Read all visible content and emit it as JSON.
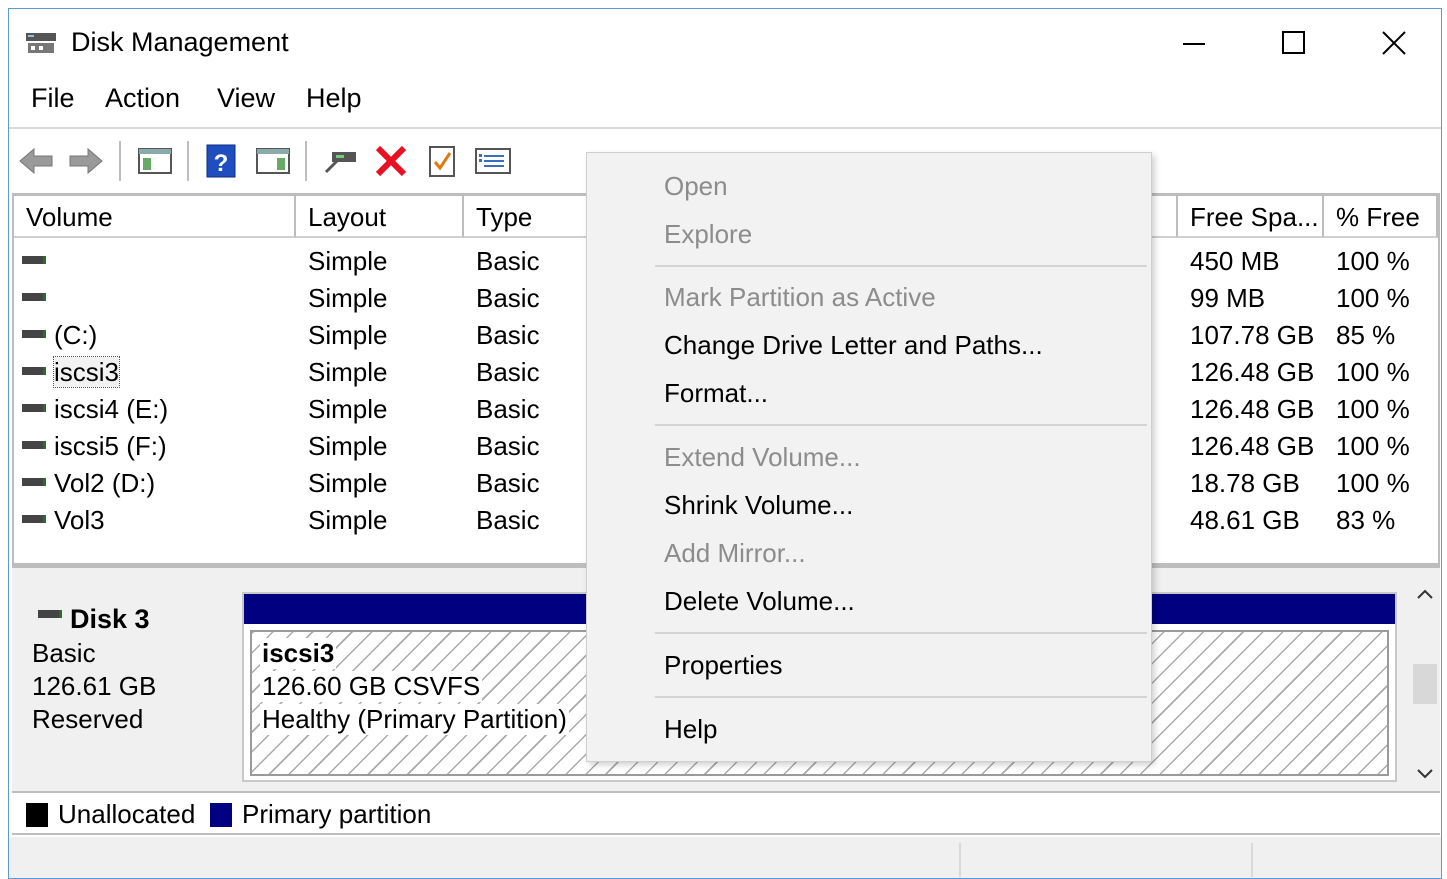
{
  "window": {
    "title": "Disk Management"
  },
  "menubar": {
    "items": [
      "File",
      "Action",
      "View",
      "Help"
    ]
  },
  "volume_table": {
    "columns": {
      "volume": "Volume",
      "layout": "Layout",
      "type": "Type",
      "free": "Free Spa...",
      "pct": "% Free"
    },
    "rows": [
      {
        "volume": "",
        "layout": "Simple",
        "type": "Basic",
        "free": "450 MB",
        "pct": "100 %"
      },
      {
        "volume": "",
        "layout": "Simple",
        "type": "Basic",
        "free": "99 MB",
        "pct": "100 %"
      },
      {
        "volume": "(C:)",
        "layout": "Simple",
        "type": "Basic",
        "free": "107.78 GB",
        "pct": "85 %"
      },
      {
        "volume": "iscsi3",
        "layout": "Simple",
        "type": "Basic",
        "free": "126.48 GB",
        "pct": "100 %"
      },
      {
        "volume": "iscsi4 (E:)",
        "layout": "Simple",
        "type": "Basic",
        "free": "126.48 GB",
        "pct": "100 %"
      },
      {
        "volume": "iscsi5 (F:)",
        "layout": "Simple",
        "type": "Basic",
        "free": "126.48 GB",
        "pct": "100 %"
      },
      {
        "volume": "Vol2 (D:)",
        "layout": "Simple",
        "type": "Basic",
        "free": "18.78 GB",
        "pct": "100 %"
      },
      {
        "volume": "Vol3",
        "layout": "Simple",
        "type": "Basic",
        "free": "48.61 GB",
        "pct": "83 %"
      }
    ]
  },
  "disk": {
    "name": "Disk 3",
    "kind": "Basic",
    "size": "126.61 GB",
    "state": "Reserved",
    "volume": {
      "name": "iscsi3",
      "size_fs": "126.60 GB CSVFS",
      "status": "Healthy (Primary Partition)"
    }
  },
  "legend": {
    "unallocated": "Unallocated",
    "primary": "Primary partition"
  },
  "colors": {
    "primary_partition": "#000080",
    "unallocated": "#000000",
    "delete_icon": "#e81123"
  },
  "context_menu": {
    "open": "Open",
    "explore": "Explore",
    "mark_active": "Mark Partition as Active",
    "change_letter": "Change Drive Letter and Paths...",
    "format": "Format...",
    "extend": "Extend Volume...",
    "shrink": "Shrink Volume...",
    "add_mirror": "Add Mirror...",
    "delete": "Delete Volume...",
    "properties": "Properties",
    "help": "Help"
  }
}
